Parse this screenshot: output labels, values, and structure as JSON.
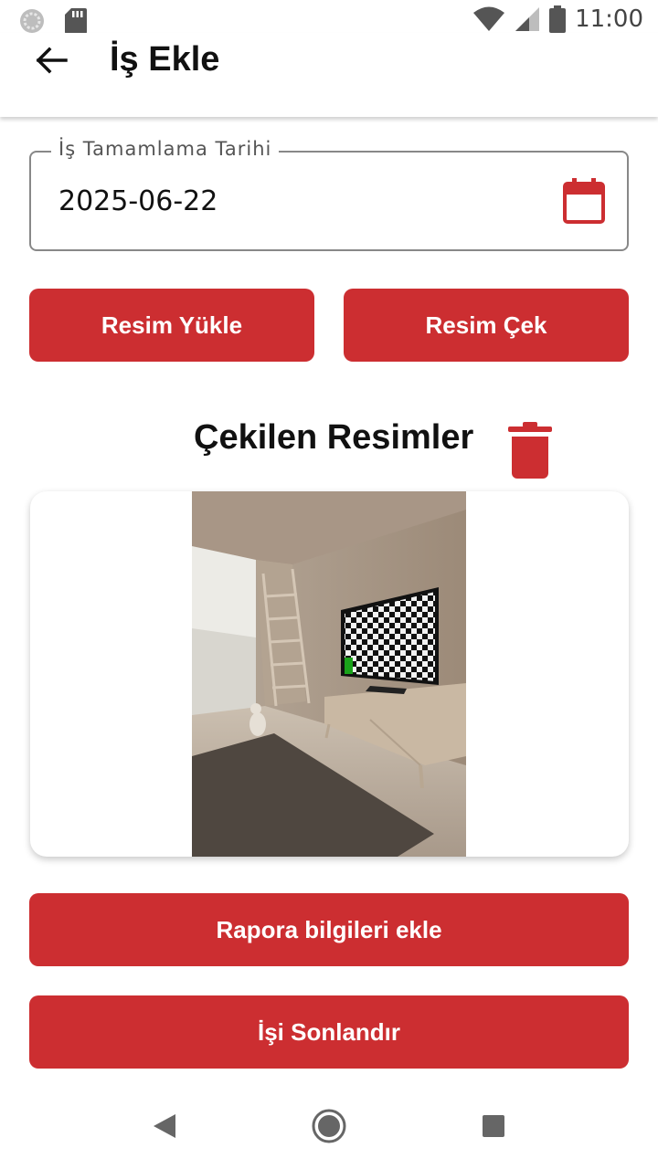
{
  "status_bar": {
    "time": "11:00",
    "icons": [
      "sync-icon",
      "sd-card-icon",
      "wifi-icon",
      "cellular-signal-icon",
      "battery-icon"
    ]
  },
  "app_bar": {
    "title": "İş Ekle",
    "back_icon": "arrow-left-icon"
  },
  "date_field": {
    "label": "İş Tamamlama Tarihi",
    "value": "2025-06-22",
    "icon": "calendar-icon"
  },
  "image_actions": {
    "upload_label": "Resim Yükle",
    "capture_label": "Resim Çek"
  },
  "photos_section": {
    "title": "Çekilen Resimler",
    "delete_icon": "trash-icon"
  },
  "actions": {
    "add_report_label": "Rapora bilgileri ekle",
    "finish_label": "İşi Sonlandır"
  },
  "colors": {
    "accent": "#cc2e31",
    "text": "#111111",
    "outline": "#888888"
  },
  "nav_bar": {
    "icons": [
      "back-triangle-icon",
      "home-circle-icon",
      "recents-square-icon"
    ]
  }
}
